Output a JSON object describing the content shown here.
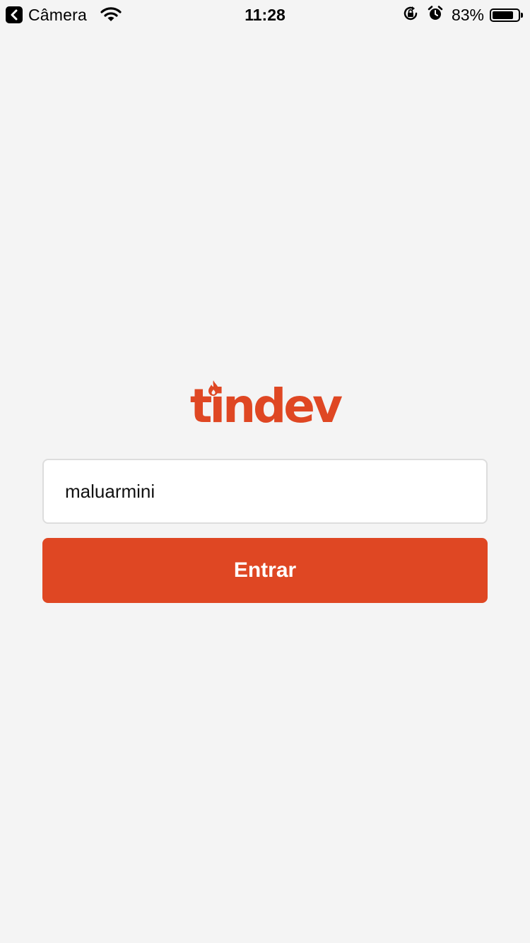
{
  "status_bar": {
    "back_app_label": "Câmera",
    "time": "11:28",
    "battery_percent": "83%",
    "battery_level": 0.83,
    "icons": [
      "back-arrow-icon",
      "wifi-icon",
      "rotation-lock-icon",
      "alarm-icon",
      "battery-icon"
    ]
  },
  "login": {
    "logo_text": "tindev",
    "username_value": "maluarmini",
    "submit_label": "Entrar"
  },
  "colors": {
    "accent": "#df4723",
    "background": "#f4f4f4",
    "input_border": "#dddddd"
  }
}
